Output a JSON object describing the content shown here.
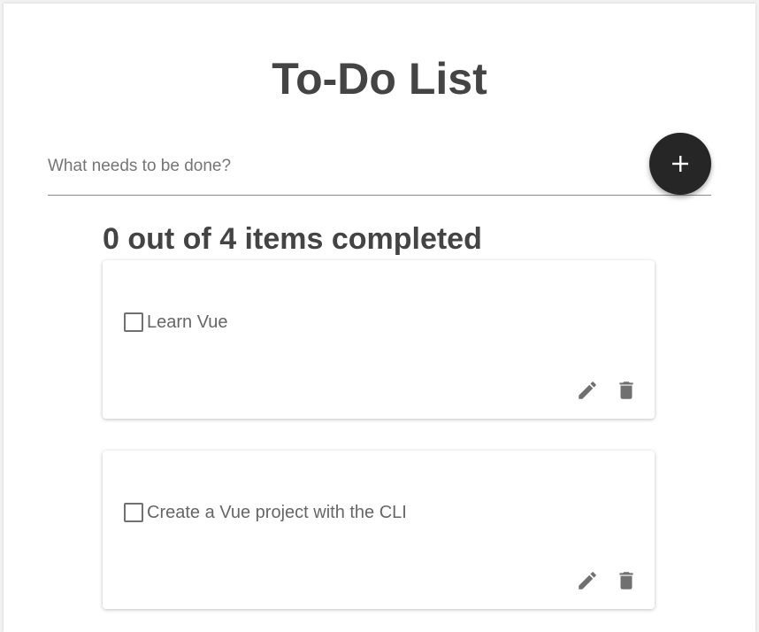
{
  "header": {
    "title": "To-Do List"
  },
  "new_todo": {
    "placeholder": "What needs to be done?",
    "value": "",
    "add_label": "+"
  },
  "summary": {
    "text": "0 out of 4 items completed",
    "completed": 0,
    "total": 4
  },
  "todos": [
    {
      "label": "Learn Vue",
      "completed": false
    },
    {
      "label": "Create a Vue project with the CLI",
      "completed": false
    }
  ],
  "icons": {
    "add": "plus-icon",
    "edit": "pencil-icon",
    "delete": "trash-icon"
  },
  "colors": {
    "title_text": "#444444",
    "fab_background": "#262626",
    "icon_gray": "#707070",
    "item_text": "#666666"
  }
}
